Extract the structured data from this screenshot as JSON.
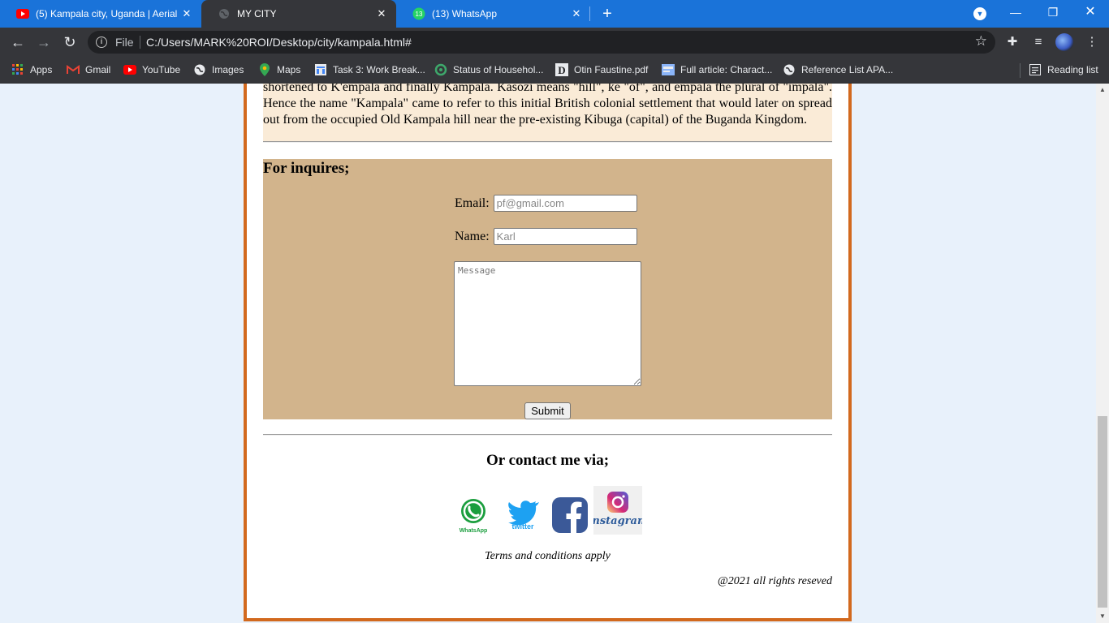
{
  "tabs": [
    {
      "title": "(5) Kampala city, Uganda | Aerial",
      "icon": "youtube-icon"
    },
    {
      "title": "MY CITY",
      "icon": "globe-icon"
    },
    {
      "title": "(13) WhatsApp",
      "icon": "whatsapp-icon",
      "badge": "13"
    }
  ],
  "toolbar": {
    "file_label": "File",
    "url": "C:/Users/MARK%20ROI/Desktop/city/kampala.html#"
  },
  "bookmarks": [
    {
      "label": "Apps",
      "icon": "apps-grid-icon"
    },
    {
      "label": "Gmail",
      "icon": "gmail-icon"
    },
    {
      "label": "YouTube",
      "icon": "youtube-icon"
    },
    {
      "label": "Images",
      "icon": "globe-icon"
    },
    {
      "label": "Maps",
      "icon": "maps-pin-icon"
    },
    {
      "label": "Task 3: Work Break...",
      "icon": "doc-icon"
    },
    {
      "label": "Status of Househol...",
      "icon": "circle-icon"
    },
    {
      "label": "Otin Faustine.pdf",
      "icon": "d-icon"
    },
    {
      "label": "Full article: Charact...",
      "icon": "article-icon"
    },
    {
      "label": "Reference List APA...",
      "icon": "globe-icon"
    }
  ],
  "reading_list": {
    "label": "Reading list",
    "icon": "reading-list-icon"
  },
  "page": {
    "history_text": "shortened to K'empala and finally Kampala. Kasozi means \"hill\", ke \"of\", and empala the plural of \"impala\". Hence the name \"Kampala\" came to refer to this initial British colonial settlement that would later on spread out from the occupied Old Kampala hill near the pre-existing Kibuga (capital) of the Buganda Kingdom.",
    "inquiry": {
      "heading": "For inquires;",
      "email_label": "Email:",
      "email_placeholder": "pf@gmail.com",
      "name_label": "Name:",
      "name_placeholder": "Karl",
      "message_placeholder": "Message",
      "submit_label": "Submit"
    },
    "contact_heading": "Or contact me via;",
    "social": [
      {
        "name": "WhatsApp",
        "color": "#25d366"
      },
      {
        "name": "twitter",
        "color": "#1da1f2"
      },
      {
        "name": "Facebook",
        "color": "#3b5998"
      },
      {
        "name": "Instagram",
        "color": "#e1306c"
      }
    ],
    "terms": "Terms and conditions apply",
    "copyright": "@2021 all rights reseved"
  },
  "colors": {
    "tab_bar": "#1a73d9",
    "chrome_dark": "#35363a",
    "page_bg": "#e8f1fb",
    "frame_border": "#d2691e",
    "history_bg": "#faebd7",
    "form_bg": "#d2b48c"
  }
}
